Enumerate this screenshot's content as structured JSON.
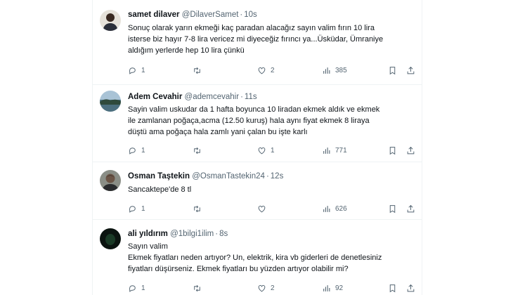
{
  "tweets": [
    {
      "name": "samet dilaver",
      "handle": "@DilaverSamet",
      "time": "10s",
      "lines": [
        "Sonuç olarak yarın ekmeği kaç paradan alacağız sayın valim fırın 10 lira",
        "isterse biz hayır 7-8 lira vericez mi diyeceğiz fırıncı ya...Üsküdar, Ümraniye",
        "aldığım yerlerde hep 10 lira çünkü"
      ],
      "replies": "1",
      "retweets": "",
      "likes": "2",
      "views": "385"
    },
    {
      "name": "Adem Cevahir",
      "handle": "@ademcevahir",
      "time": "11s",
      "lines": [
        "Sayin valim uskudar da 1 hafta boyunca 10 liradan ekmek aldık ve ekmek",
        "ile zamlanan poğaça,acma (12.50 kuruş) hala aynı fiyat ekmek 8 liraya",
        "düştü ama poğaça hala zamlı yani çalan bu işte karlı"
      ],
      "replies": "1",
      "retweets": "",
      "likes": "1",
      "views": "771"
    },
    {
      "name": "Osman Taştekin",
      "handle": "@OsmanTastekin24",
      "time": "12s",
      "lines": [
        "Sancaktepe'de 8 tl"
      ],
      "replies": "1",
      "retweets": "",
      "likes": "",
      "views": "626"
    },
    {
      "name": "ali yıldırım",
      "handle": "@1bilgi1ilim",
      "time": "8s",
      "lines": [
        "Sayın valim",
        "Ekmek fiyatları neden artıyor? Un, elektrik, kira vb giderleri de denetlesiniz",
        "fiyatları düşürseniz. Ekmek fiyatları bu yüzden artıyor olabilir mi?"
      ],
      "replies": "1",
      "retweets": "",
      "likes": "2",
      "views": "92"
    }
  ],
  "separator": "·",
  "icons": [
    "reply-icon",
    "retweet-icon",
    "like-icon",
    "views-icon",
    "bookmark-icon",
    "share-icon"
  ],
  "colors": {
    "text": "#0f1419",
    "muted": "#536471",
    "border": "#eff3f4"
  }
}
